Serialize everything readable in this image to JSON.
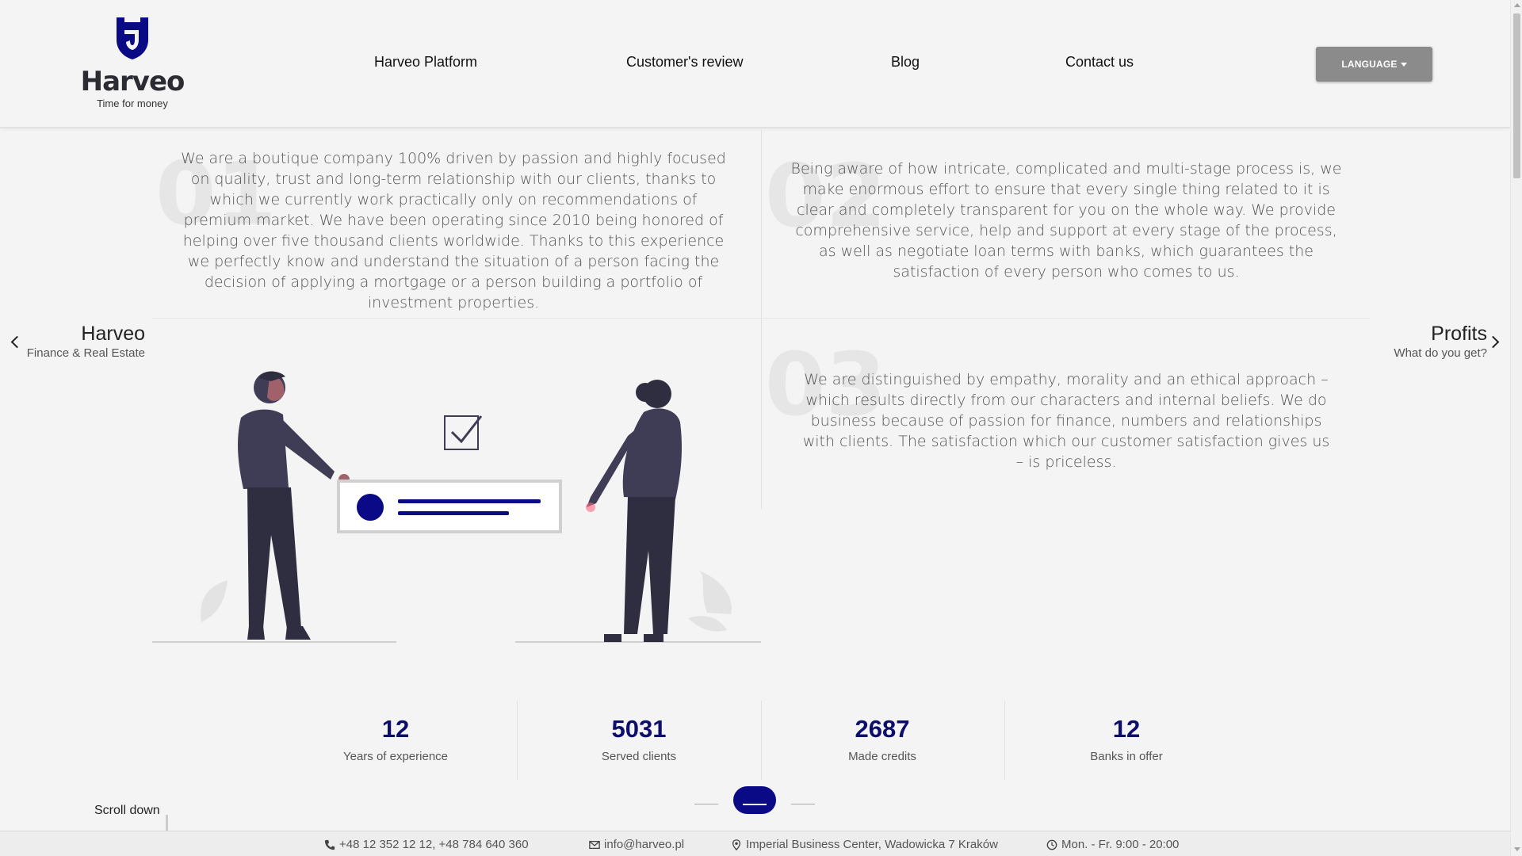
{
  "header": {
    "logo_name": "Harveo",
    "logo_tagline": "Time for money",
    "nav": [
      {
        "label": "Harveo Platform"
      },
      {
        "label": "Customer's review"
      },
      {
        "label": "Blog"
      },
      {
        "label": "Contact us"
      }
    ],
    "language_label": "LANGUAGE"
  },
  "blocks": [
    {
      "number": "01",
      "text": "We are a boutique company 100% driven by passion and highly focused on quality, trust and long-term relationship with our clients, thanks to which we currently work practically only on recommendations of premium market. We have been operating since 2010 being honored of helping over five thousand clients worldwide. Thanks to this experience we perfectly know and understand the situation of a person facing the decision of applying a mortgage or a person building a portfolio of investment properties."
    },
    {
      "number": "02",
      "text": "Being aware of how intricate, complicated and multi-stage process is, we make enormous effort to ensure that every single thing related to it is clear and completely transparent for you on the whole way. We provide comprehensive service, help and support at every stage of the process, as well as negotiate loan terms with banks, which guarantees the satisfaction of every person who comes to us."
    },
    {
      "number": "03",
      "text": "We are distinguished by empathy, morality and an ethical approach – which results directly from our characters and internal beliefs. We do business because of passion for finance, numbers and relationships with clients. The satisfaction which our customer satisfaction gives us – is priceless."
    }
  ],
  "side_nav": {
    "prev_title": "Harveo",
    "prev_subtitle": "Finance & Real Estate",
    "next_title": "Profits",
    "next_subtitle": "What do you get?"
  },
  "stats": [
    {
      "value": "12",
      "label": "Years of experience"
    },
    {
      "value": "5031",
      "label": "Served clients"
    },
    {
      "value": "2687",
      "label": "Made credits"
    },
    {
      "value": "12",
      "label": "Banks in offer"
    }
  ],
  "scroll_hint": "Scroll down",
  "footer": {
    "phone": "+48 12 352 12 12, +48 784 640 360",
    "email": "info@harveo.pl",
    "address": "Imperial Business Center, Wadowicka 7 Kraków",
    "hours": "Mon. - Fr. 9:00 - 20:00"
  },
  "colors": {
    "brand": "#0a0a86",
    "logo_dark": "#2b2b33",
    "button_gray": "#8b8b8b",
    "illustration_suit": "#3f3d56"
  },
  "icons": [
    "logo-shield-icon",
    "chevron-left-icon",
    "chevron-right-icon",
    "phone-icon",
    "envelope-icon",
    "map-pin-icon",
    "clock-icon",
    "checkbox-icon"
  ]
}
